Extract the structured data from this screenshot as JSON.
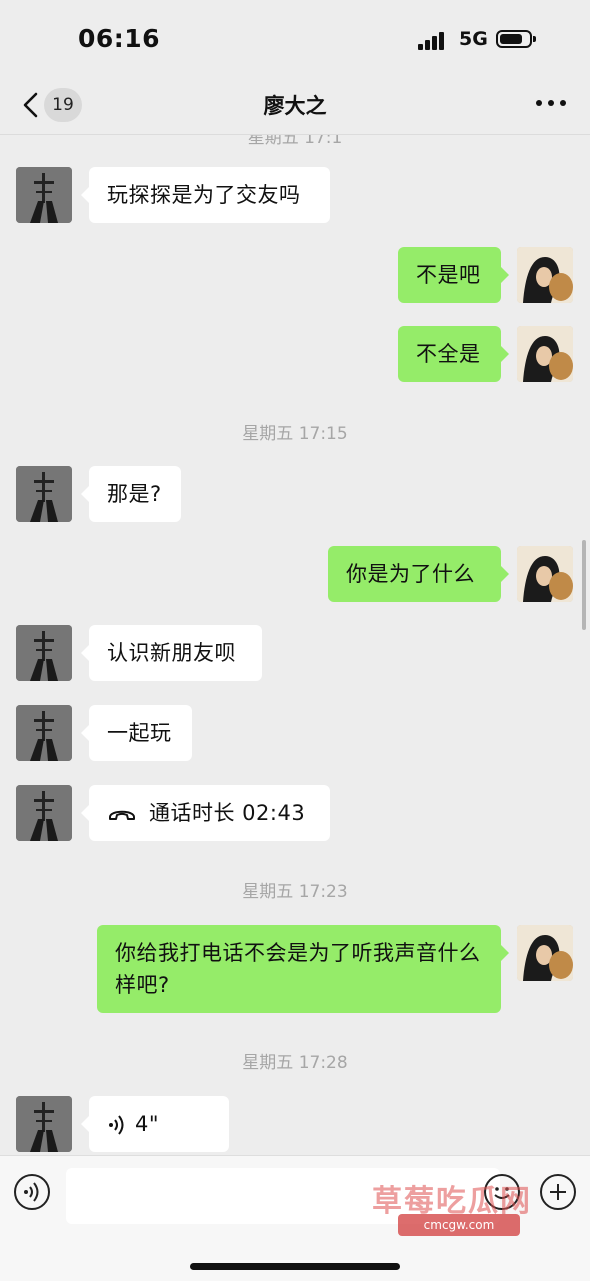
{
  "status_bar": {
    "time": "06:16",
    "network": "5G",
    "battery_level": 0.8
  },
  "nav": {
    "unread_count": "19",
    "title": "廖大之"
  },
  "messages": {
    "top_separator": "星期五 17:1",
    "m1": "玩探探是为了交友吗",
    "m2": "不是吧",
    "m3": "不全是",
    "sep2": "星期五 17:15",
    "m4": "那是?",
    "m5": "你是为了什么",
    "m6": "认识新朋友呗",
    "m7": "一起玩",
    "m8": "通话时长 02:43",
    "sep3": "星期五 17:23",
    "m9": "你给我打电话不会是为了听我声音什么样吧?",
    "sep4": "星期五 17:28",
    "m10": "4\""
  },
  "input_bar": {
    "placeholder": ""
  },
  "watermark": {
    "text": "草莓吃瓜网",
    "url": "cmcgw.com"
  },
  "colors": {
    "background": "#ededed",
    "sent_bubble": "#95ec69",
    "received_bubble": "#ffffff"
  },
  "icons": [
    "back-icon",
    "more-icon",
    "phone-icon",
    "voice-wave-icon",
    "voice-toggle-icon",
    "emoji-icon",
    "plus-icon"
  ]
}
